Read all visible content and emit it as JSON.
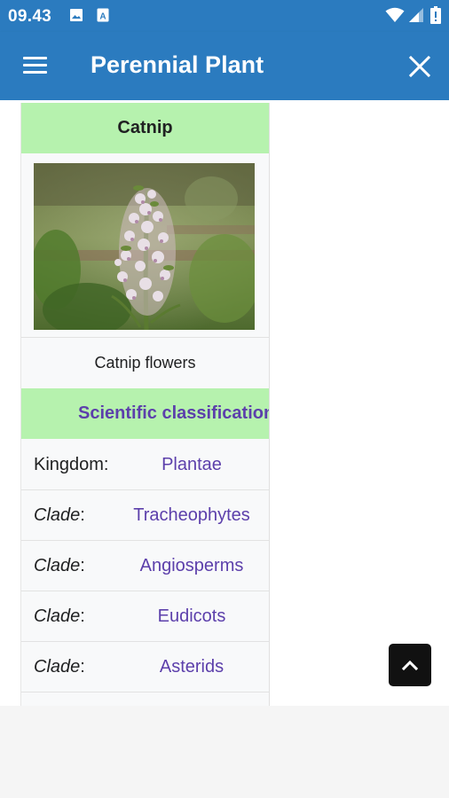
{
  "status_bar": {
    "time": "09.43",
    "icons": [
      "image-icon",
      "text-a-icon",
      "wifi-icon",
      "signal-icon",
      "battery-icon"
    ]
  },
  "app_bar": {
    "title": "Perennial Plant",
    "menu_icon": "menu-icon",
    "close_icon": "close-icon"
  },
  "infobox": {
    "title": "Catnip",
    "image_caption": "Catnip flowers",
    "section_title": "Scientific classification",
    "rows": [
      {
        "label": "Kingdom:",
        "label_text": "Kingdom",
        "label_italic": false,
        "value": "Plantae"
      },
      {
        "label": "Clade:",
        "label_text": "Clade",
        "label_italic": true,
        "value": "Tracheophytes"
      },
      {
        "label": "Clade:",
        "label_text": "Clade",
        "label_italic": true,
        "value": "Angiosperms"
      },
      {
        "label": "Clade:",
        "label_text": "Clade",
        "label_italic": true,
        "value": "Eudicots"
      },
      {
        "label": "Clade:",
        "label_text": "Clade",
        "label_italic": true,
        "value": "Asterids"
      }
    ]
  },
  "scroll_top_button": {
    "icon": "chevron-up-icon"
  },
  "colors": {
    "app_bar": "#2b7bbf",
    "header_green": "#b6f2ae",
    "link_purple": "#5c3fab",
    "infobox_bg": "#f8f9fa"
  }
}
